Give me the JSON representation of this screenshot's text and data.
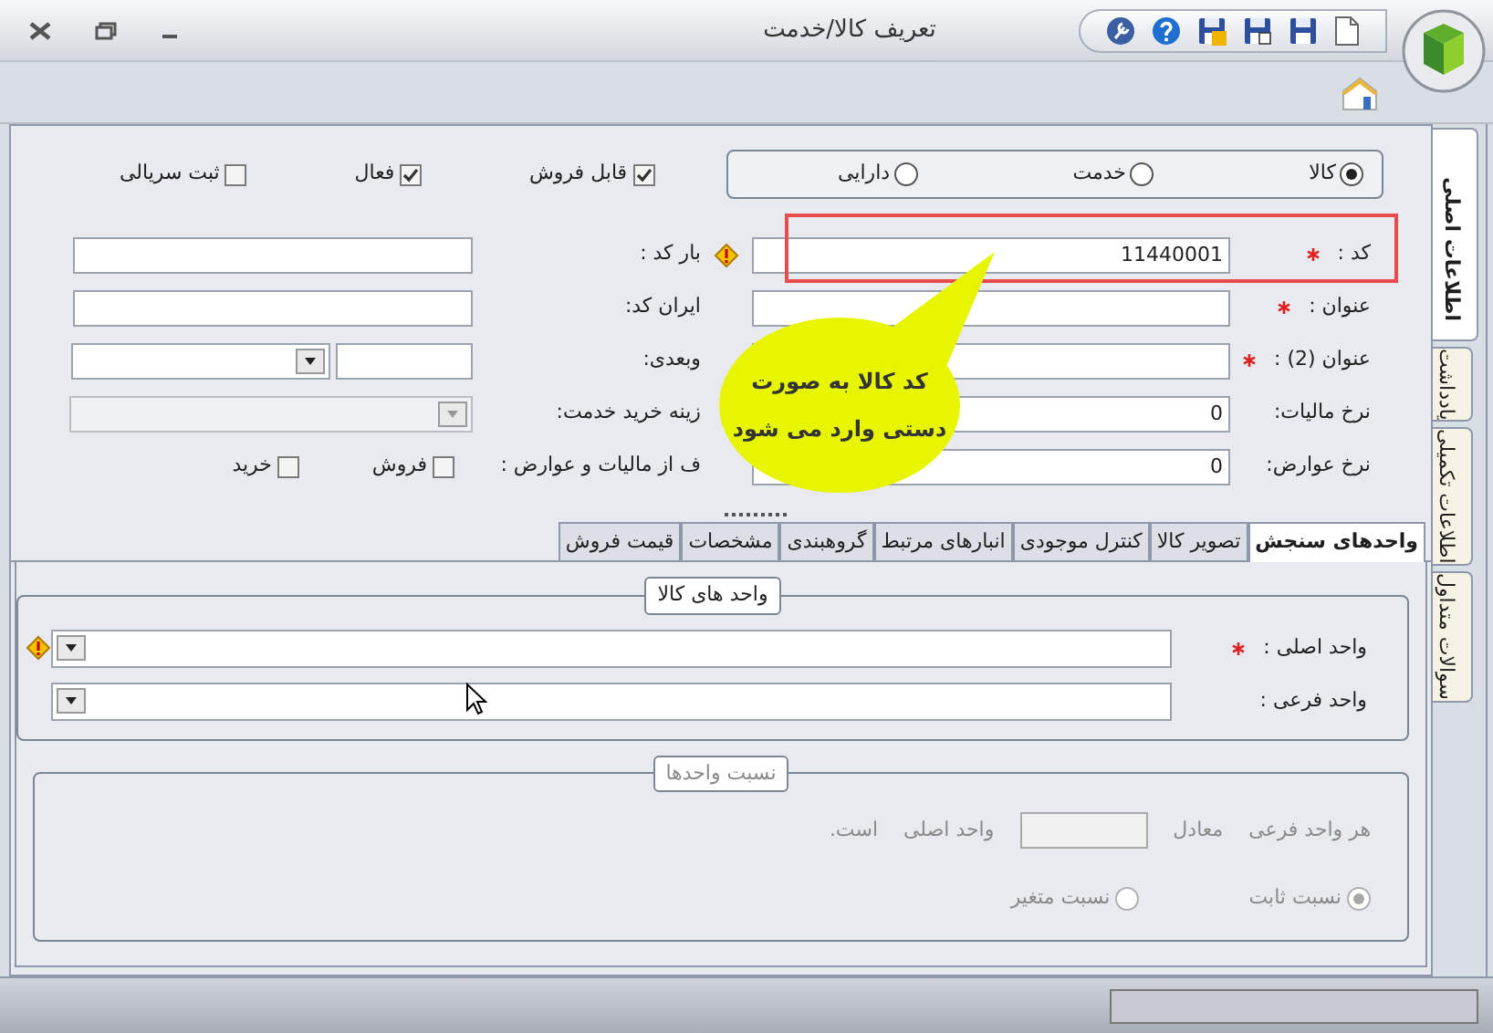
{
  "window": {
    "title": "تعریف کالا/خدمت"
  },
  "item_type": [
    {
      "label": "کالا",
      "selected": true
    },
    {
      "label": "خدمت",
      "selected": false
    },
    {
      "label": "دارایی",
      "selected": false
    }
  ],
  "flags": [
    {
      "label": "قابل فروش",
      "checked": true
    },
    {
      "label": "فعال",
      "checked": true
    },
    {
      "label": "ثبت سریالی",
      "checked": false
    }
  ],
  "rows": [
    {
      "label": "کد :",
      "required": true,
      "value": "11440001",
      "side": {
        "kind": "text",
        "label": "بار کد :",
        "warning": true
      }
    },
    {
      "label": "عنوان :",
      "required": true,
      "side": {
        "kind": "text",
        "label": "ایران کد:"
      }
    },
    {
      "label": "عنوان (2) :",
      "required": true,
      "side": {
        "kind": "combo_text",
        "label": "وبعدی:"
      }
    },
    {
      "label": "نرخ مالیات:",
      "required": false,
      "value": "0",
      "side": {
        "kind": "combo",
        "label": "زینه خرید خدمت:",
        "disabled": true
      }
    },
    {
      "label": "نرخ عوارض:",
      "required": false,
      "value": "0",
      "side": {
        "kind": "checks",
        "label": "ف از مالیات و عوارض :",
        "options": [
          {
            "label": "فروش",
            "checked": false
          },
          {
            "label": "خرید",
            "checked": false
          }
        ]
      }
    }
  ],
  "tabs": [
    {
      "label": "واحدهای سنجش",
      "selected": true
    },
    {
      "label": "تصویر کالا",
      "selected": false
    },
    {
      "label": "کنترل موجودی",
      "selected": false
    },
    {
      "label": "انبارهای مرتبط",
      "selected": false
    },
    {
      "label": "گروهبندی",
      "selected": false
    },
    {
      "label": "مشخصات",
      "selected": false
    },
    {
      "label": "قیمت فروش",
      "selected": false
    }
  ],
  "units": {
    "title": "واحد های کالا",
    "fields": [
      {
        "label": "واحد اصلی :",
        "required": true,
        "warning": true
      },
      {
        "label": "واحد فرعی :",
        "required": false
      }
    ]
  },
  "ratio": {
    "title": "نسبت واحدها",
    "disabled": true,
    "sentence": [
      "هر واحد فرعی",
      "معادل",
      "واحد اصلی",
      "است."
    ],
    "options": [
      {
        "label": "نسبت ثابت",
        "selected": true
      },
      {
        "label": "نسبت متغیر",
        "selected": false
      }
    ]
  },
  "side_tabs": [
    {
      "label": "اطلاعات اصلی",
      "selected": true
    },
    {
      "label": "یادداشت",
      "selected": false
    },
    {
      "label": "اطلاعات تکمیلی",
      "selected": false
    },
    {
      "label": "سوالات متداول",
      "selected": false
    }
  ],
  "callout": {
    "lines": [
      "کد کالا به صورت",
      "دستی وارد می شود"
    ]
  }
}
